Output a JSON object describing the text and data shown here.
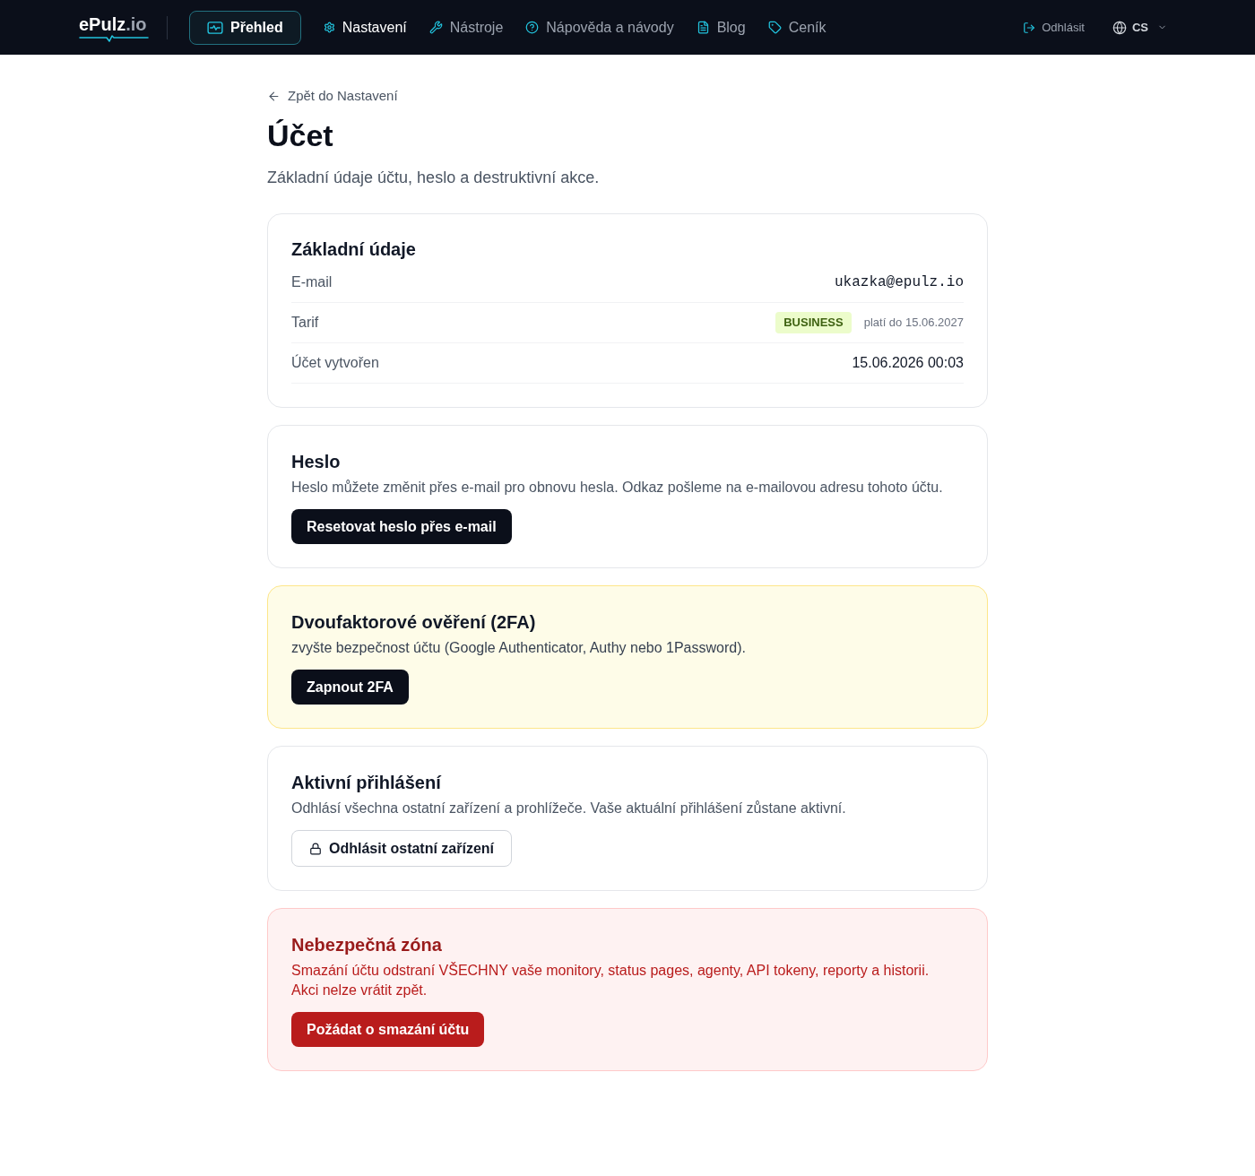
{
  "nav": {
    "logo": {
      "name": "ePulz",
      "suffix": ".io"
    },
    "items": [
      {
        "label": "Přehled",
        "selected": true,
        "active": true
      },
      {
        "label": "Nastavení",
        "selected": false,
        "active": true
      },
      {
        "label": "Nástroje",
        "selected": false,
        "active": false
      },
      {
        "label": "Nápověda a návody",
        "selected": false,
        "active": false
      },
      {
        "label": "Blog",
        "selected": false,
        "active": false
      },
      {
        "label": "Ceník",
        "selected": false,
        "active": false
      }
    ],
    "logout": "Odhlásit",
    "language": "CS"
  },
  "back_link": "Zpět do Nastavení",
  "title": "Účet",
  "subtitle": "Základní údaje účtu, heslo a destruktivní akce.",
  "cards": [
    {
      "kind": "default",
      "title": "Základní údaje",
      "rows": [
        {
          "kind": "mono",
          "label": "E-mail",
          "value": "ukazka@epulz.io"
        },
        {
          "kind": "plan",
          "label": "Tarif",
          "badge": "BUSINESS",
          "note": "platí do 15.06.2027"
        },
        {
          "kind": "text",
          "label": "Účet vytvořen",
          "value": "15.06.2026 00:03"
        }
      ]
    },
    {
      "kind": "default",
      "title": "Heslo",
      "text": "Heslo můžete změnit přes e-mail pro obnovu hesla. Odkaz pošleme na e-mailovou adresu tohoto účtu.",
      "button": {
        "kind": "primary",
        "label": "Resetovat heslo přes e-mail"
      }
    },
    {
      "kind": "warning",
      "title": "Dvoufaktorové ověření (2FA)",
      "text": "zvyšte bezpečnost účtu (Google Authenticator, Authy nebo 1Password).",
      "button": {
        "kind": "primary",
        "label": "Zapnout 2FA"
      }
    },
    {
      "kind": "default",
      "title": "Aktivní přihlášení",
      "text": "Odhlásí všechna ostatní zařízení a prohlížeče. Vaše aktuální přihlášení zůstane aktivní.",
      "button": {
        "kind": "outline",
        "label": "Odhlásit ostatní zařízení"
      }
    },
    {
      "kind": "danger",
      "title": "Nebezpečná zóna",
      "text": "Smazání účtu odstraní VŠECHNY vaše monitory, status pages, agenty, API tokeny, reporty a historii.\nAkci nelze vrátit zpět.",
      "button": {
        "kind": "danger",
        "label": "Požádat o smazání účtu"
      }
    }
  ]
}
